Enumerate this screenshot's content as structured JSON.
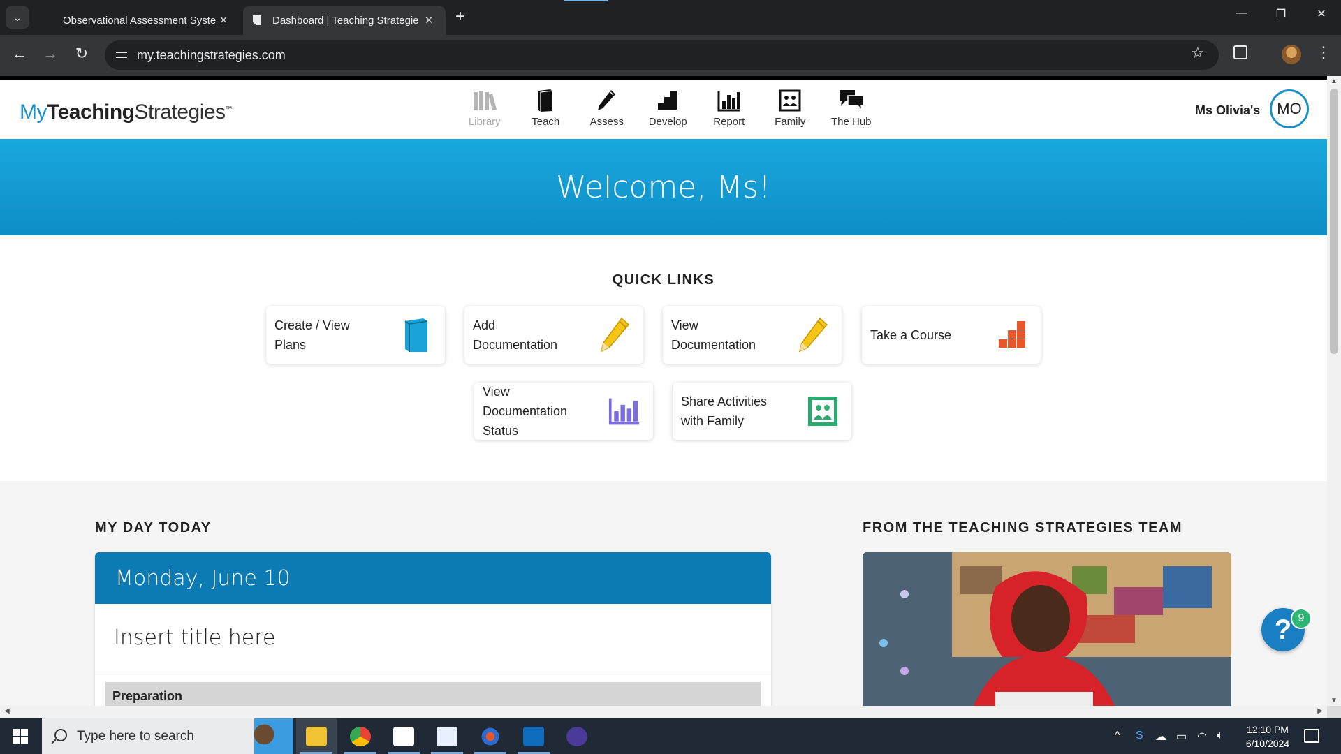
{
  "browser": {
    "tabs": [
      {
        "title": "Observational Assessment Syste",
        "active": false
      },
      {
        "title": "Dashboard | Teaching Strategie",
        "active": true
      }
    ],
    "url": "my.teachingstrategies.com"
  },
  "app": {
    "logo": {
      "my": "My",
      "bold": "Teaching",
      "rest": "Strategies",
      "tm": "™"
    },
    "nav": [
      {
        "label": "Library",
        "icon": "library-icon",
        "disabled": true
      },
      {
        "label": "Teach",
        "icon": "book-icon"
      },
      {
        "label": "Assess",
        "icon": "pencil-icon"
      },
      {
        "label": "Develop",
        "icon": "blocks-icon"
      },
      {
        "label": "Report",
        "icon": "bar-chart-icon"
      },
      {
        "label": "Family",
        "icon": "family-photo-icon"
      },
      {
        "label": "The Hub",
        "icon": "chat-bubbles-icon"
      }
    ],
    "user": {
      "name": "Ms Olivia's",
      "initials": "MO"
    }
  },
  "hero": {
    "welcome": "Welcome, Ms!"
  },
  "quick_links": {
    "title": "QUICK LINKS",
    "items": [
      {
        "label_lines": [
          "Create / View",
          "Plans"
        ],
        "icon": "blue-book-icon",
        "color": "#1aa3d9"
      },
      {
        "label_lines": [
          "Add",
          "Documentation"
        ],
        "icon": "yellow-pencil-icon",
        "color": "#f5c518"
      },
      {
        "label_lines": [
          "View",
          "Documentation"
        ],
        "icon": "yellow-pencil-icon",
        "color": "#f5c518"
      },
      {
        "label_lines": [
          "Take a Course"
        ],
        "icon": "orange-blocks-icon",
        "color": "#e8572a"
      },
      {
        "label_lines": [
          "View",
          "Documentation",
          "Status"
        ],
        "icon": "purple-chart-icon",
        "color": "#7b6ee0"
      },
      {
        "label_lines": [
          "Share Activities",
          "with Family"
        ],
        "icon": "green-family-icon",
        "color": "#2bab6e"
      }
    ]
  },
  "my_day": {
    "title": "MY DAY TODAY",
    "date": "Monday, June 10",
    "entry_title": "Insert title here",
    "section": "Preparation"
  },
  "team": {
    "title": "FROM THE TEACHING STRATEGIES TEAM"
  },
  "help": {
    "symbol": "?",
    "badge": "9"
  },
  "taskbar": {
    "search_placeholder": "Type here to search",
    "time": "12:10 PM",
    "date": "6/10/2024"
  }
}
